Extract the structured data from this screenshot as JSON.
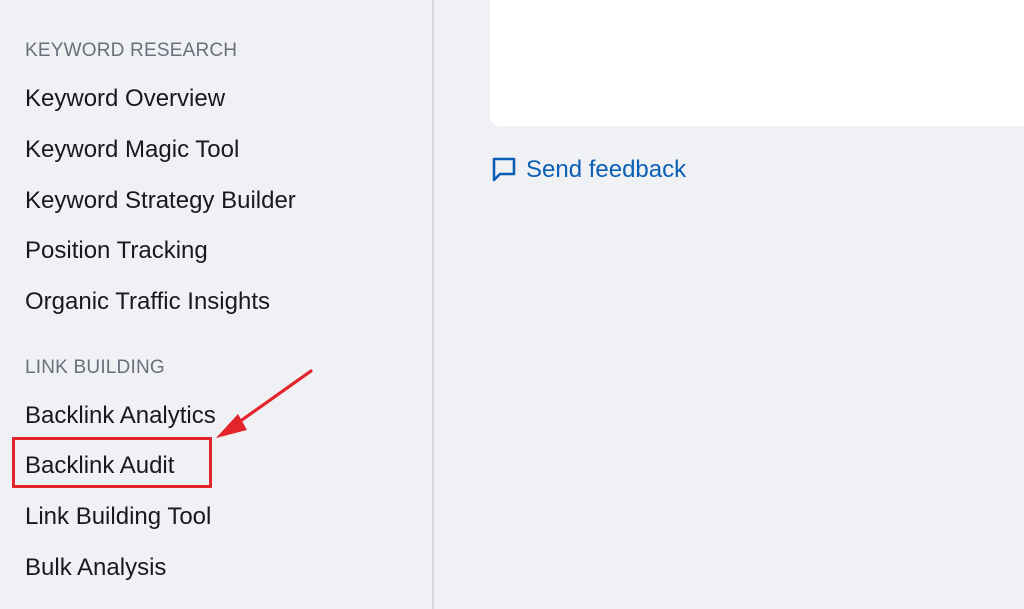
{
  "sidebar": {
    "sections": [
      {
        "heading": "KEYWORD RESEARCH",
        "items": [
          "Keyword Overview",
          "Keyword Magic Tool",
          "Keyword Strategy Builder",
          "Position Tracking",
          "Organic Traffic Insights"
        ]
      },
      {
        "heading": "LINK BUILDING",
        "items": [
          "Backlink Analytics",
          "Backlink Audit",
          "Link Building Tool",
          "Bulk Analysis"
        ]
      }
    ]
  },
  "main": {
    "feedback_label": "Send feedback",
    "feedback_icon": "speech-bubble-icon"
  },
  "annotation": {
    "highlighted_item": "Backlink Audit",
    "color": "#e3242b"
  },
  "colors": {
    "background": "#f0f1f5",
    "link": "#0b5fb5",
    "heading": "#6b6f7b",
    "text": "#17191f"
  }
}
